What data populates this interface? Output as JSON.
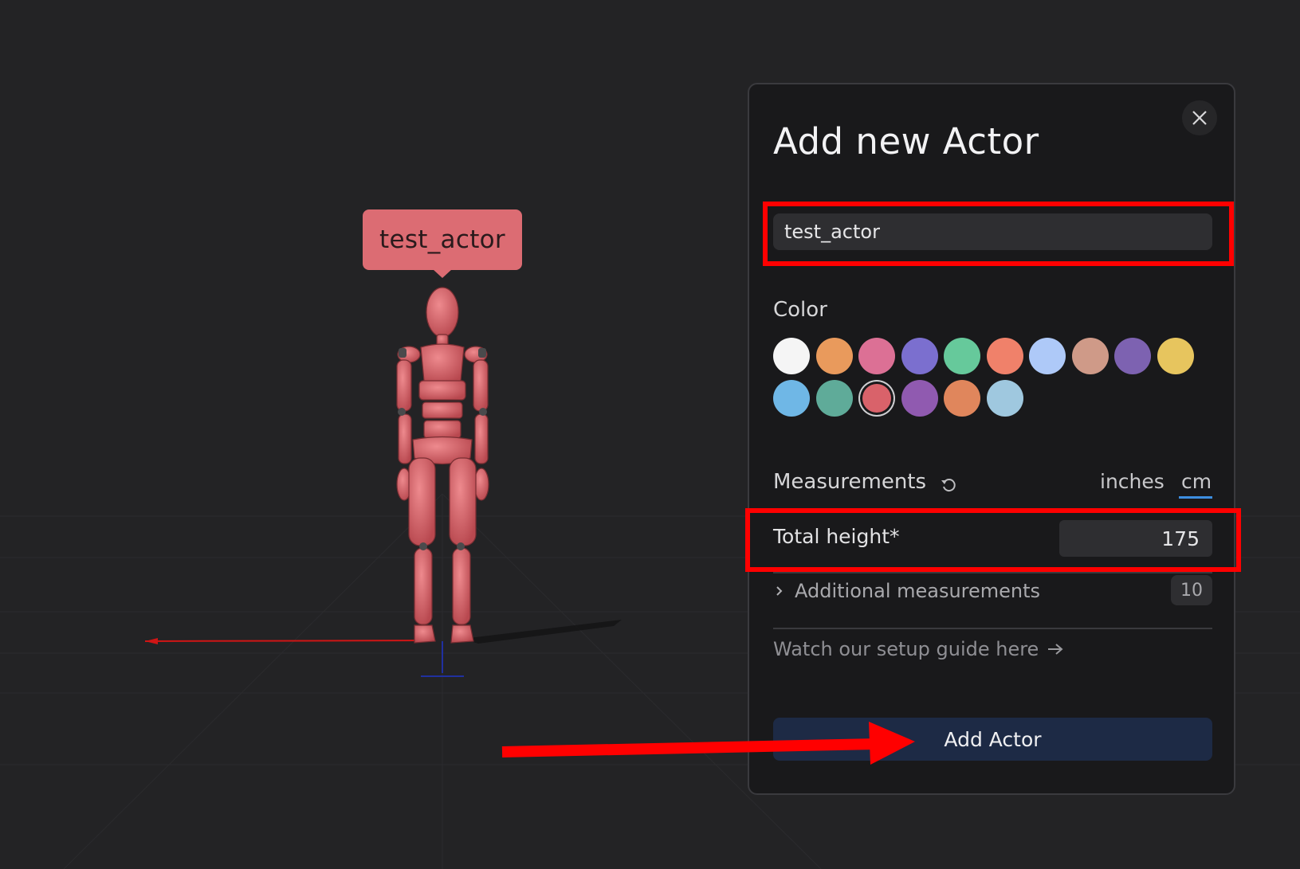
{
  "viewport": {
    "actor_tag": "test_actor"
  },
  "panel": {
    "title": "Add new Actor",
    "close_icon": "close-icon",
    "name_value": "test_actor",
    "color_label": "Color",
    "colors": [
      "#f5f5f5",
      "#e99a5c",
      "#dc7095",
      "#7b6fcf",
      "#66c99b",
      "#f0816a",
      "#aec9f8",
      "#cf9a88",
      "#7d62b1",
      "#e7c55e",
      "#6fb7e6",
      "#5fab99",
      "#d9626a",
      "#905ab0",
      "#e0865c",
      "#9fc8df"
    ],
    "selected_color": "#d9626a",
    "measurements_label": "Measurements",
    "reset_icon": "reset-icon",
    "unit_inches": "inches",
    "unit_cm": "cm",
    "active_unit": "cm",
    "total_height_label": "Total height*",
    "total_height_value": "175",
    "additional_label": "Additional measurements",
    "additional_count": "10",
    "guide_link": "Watch our setup guide here",
    "add_button": "Add Actor"
  },
  "annotations": {
    "highlight_color": "#ff0000"
  }
}
